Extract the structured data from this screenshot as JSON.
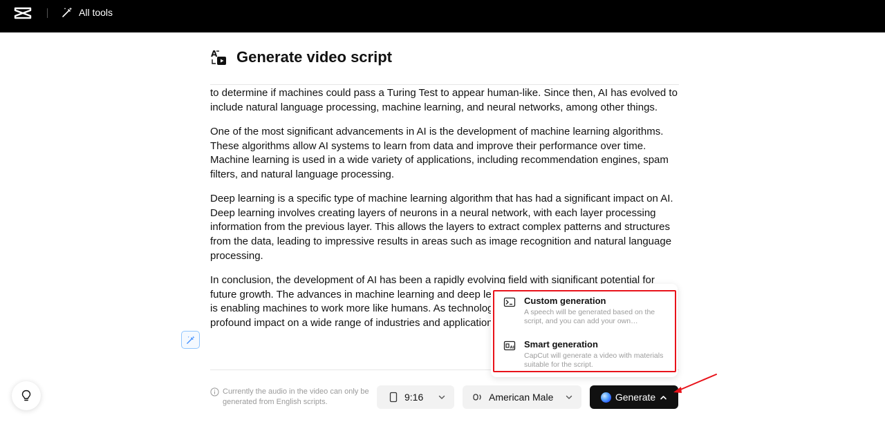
{
  "header": {
    "all_tools_label": "All tools"
  },
  "page": {
    "title": "Generate video script"
  },
  "script": {
    "paragraphs": [
      "to determine if machines could pass a Turing Test to appear human-like. Since then, AI has evolved to include natural language processing, machine learning, and neural networks, among other things.",
      "One of the most significant advancements in AI is the development of machine learning algorithms. These algorithms allow AI systems to learn from data and improve their performance over time. Machine learning is used in a wide variety of applications, including recommendation engines, spam filters, and natural language processing.",
      "Deep learning is a specific type of machine learning algorithm that has had a significant impact on AI. Deep learning involves creating layers of neurons in a neural network, with each layer processing information from the previous layer. This allows the layers to extract complex patterns and structures from the data, leading to impressive results in areas such as image recognition and natural language processing.",
      "In conclusion, the development of AI has been a rapidly evolving field with significant potential for future growth. The advances in machine learning and deep learning have been remarkable in how AI is enabling machines to work more like humans. As technology advances, AI is expected to have a profound impact on a wide range of industries and applications."
    ]
  },
  "footer": {
    "info_text": "Currently the audio in the video can only be generated from English scripts.",
    "ratio_value": "9:16",
    "voice_value": "American Male",
    "generate_label": "Generate"
  },
  "generate_menu": {
    "items": [
      {
        "title": "Custom generation",
        "description": "A speech will be generated based on the script, and you can add your own…"
      },
      {
        "title": "Smart generation",
        "description": "CapCut will generate a video with materials suitable for the script."
      }
    ]
  },
  "colors": {
    "topbar": "#000000",
    "highlight_frame": "#e8121a",
    "annotation_arrow": "#e8121a",
    "generate_button": "#111111"
  }
}
